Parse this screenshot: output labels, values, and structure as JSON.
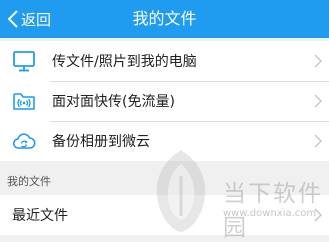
{
  "header": {
    "back_label": "返回",
    "title": "我的文件",
    "background": "#1f9cf0"
  },
  "actions": [
    {
      "label": "传文件/照片到我的电脑",
      "icon": "monitor-icon"
    },
    {
      "label": "面对面快传(免流量)",
      "icon": "folder-wifi-icon"
    },
    {
      "label": "备份相册到微云",
      "icon": "cloud-sync-icon"
    }
  ],
  "my_files": {
    "section_label": "我的文件",
    "items": [
      {
        "label": "最近文件"
      }
    ]
  },
  "watermark": {
    "brand": "当下软件园",
    "url": "www.downxia.com"
  },
  "colors": {
    "accent": "#1f9cf0",
    "background": "#f0f0f0",
    "chevron": "#c7c7cc"
  }
}
